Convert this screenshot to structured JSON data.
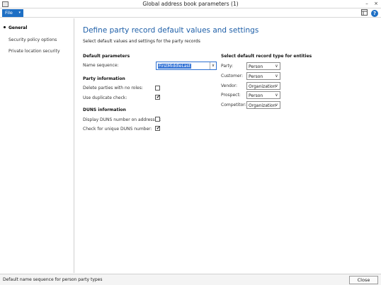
{
  "window": {
    "title": "Global address book parameters (1)",
    "minimize": "–",
    "close": "×"
  },
  "menu": {
    "file_label": "File",
    "file_arrow": "▾"
  },
  "sidebar": {
    "items": [
      {
        "label": "General",
        "active": true
      },
      {
        "label": "Security policy options",
        "active": false
      },
      {
        "label": "Private location security",
        "active": false
      }
    ]
  },
  "content": {
    "heading": "Define party record default values and settings",
    "subtitle": "Select default values and settings for the party records",
    "default_params": {
      "title": "Default parameters",
      "name_sequence_label": "Name sequence:",
      "name_sequence_value": "FirstMiddleLast"
    },
    "party_info": {
      "title": "Party information",
      "delete_label": "Delete parties with no roles:",
      "delete_checked": false,
      "duplicate_label": "Use duplicate check:",
      "duplicate_checked": true
    },
    "duns": {
      "title": "DUNS information",
      "display_label": "Display DUNS number on addresses:",
      "display_checked": false,
      "unique_label": "Check for unique DUNS number:",
      "unique_checked": true
    },
    "record_types": {
      "title": "Select default record type for entities",
      "rows": [
        {
          "label": "Party:",
          "value": "Person"
        },
        {
          "label": "Customer:",
          "value": "Person"
        },
        {
          "label": "Vendor:",
          "value": "Organization"
        },
        {
          "label": "Prospect:",
          "value": "Person"
        },
        {
          "label": "Competitor:",
          "value": "Organization"
        }
      ]
    },
    "check_glyph": "✔",
    "dropdown_glyph": "∨"
  },
  "status": {
    "text": "Default name sequence for person party types",
    "close_label": "Close"
  }
}
